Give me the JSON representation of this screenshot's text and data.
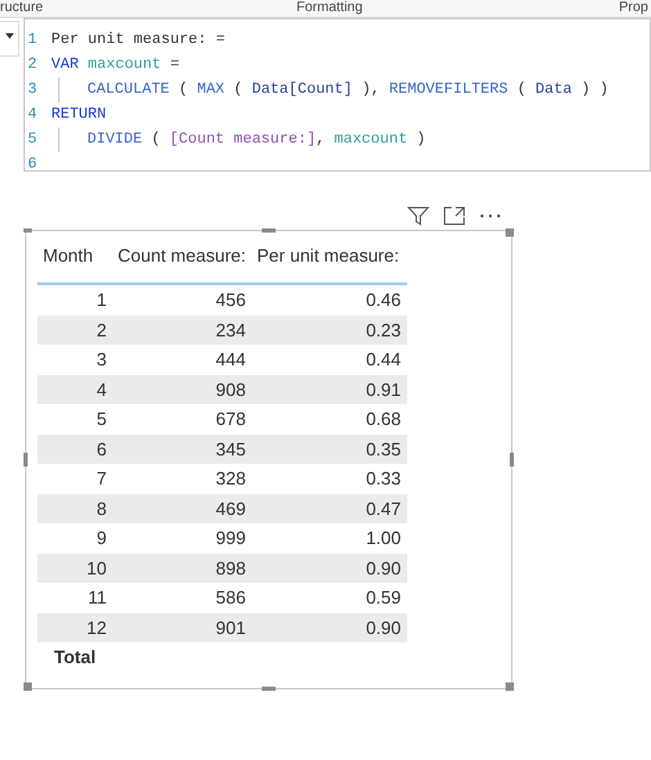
{
  "pane_tabs": [
    "ructure",
    "Formatting",
    "Prop"
  ],
  "editor": {
    "lines": [
      {
        "number": "1",
        "indent": false,
        "tokens": [
          {
            "kind": "text",
            "text": "Per unit measure: ="
          }
        ]
      },
      {
        "number": "2",
        "indent": false,
        "tokens": [
          {
            "kind": "keyword",
            "text": "VAR"
          },
          {
            "kind": "variable",
            "text": " maxcount"
          },
          {
            "kind": "text",
            "text": " ="
          }
        ]
      },
      {
        "number": "3",
        "indent": true,
        "tokens": [
          {
            "kind": "function",
            "text": "CALCULATE"
          },
          {
            "kind": "text",
            "text": " ( "
          },
          {
            "kind": "function",
            "text": "MAX"
          },
          {
            "kind": "text",
            "text": " ( "
          },
          {
            "kind": "column",
            "text": "Data[Count]"
          },
          {
            "kind": "text",
            "text": " ), "
          },
          {
            "kind": "function",
            "text": "REMOVEFILTERS"
          },
          {
            "kind": "text",
            "text": " ( "
          },
          {
            "kind": "column",
            "text": "Data"
          },
          {
            "kind": "text",
            "text": " ) )"
          }
        ]
      },
      {
        "number": "4",
        "indent": false,
        "tokens": [
          {
            "kind": "keyword",
            "text": "RETURN"
          }
        ]
      },
      {
        "number": "5",
        "indent": true,
        "tokens": [
          {
            "kind": "function",
            "text": "DIVIDE"
          },
          {
            "kind": "text",
            "text": " ( "
          },
          {
            "kind": "measure",
            "text": "[Count measure:]"
          },
          {
            "kind": "text",
            "text": ", "
          },
          {
            "kind": "variable",
            "text": "maxcount"
          },
          {
            "kind": "text",
            "text": " )"
          }
        ]
      },
      {
        "number": "6",
        "indent": false
      }
    ]
  },
  "table": {
    "columns": [
      "Month",
      "Count measure:",
      "Per unit measure:"
    ],
    "rows": [
      [
        "1",
        "456",
        "0.46"
      ],
      [
        "2",
        "234",
        "0.23"
      ],
      [
        "3",
        "444",
        "0.44"
      ],
      [
        "4",
        "908",
        "0.91"
      ],
      [
        "5",
        "678",
        "0.68"
      ],
      [
        "6",
        "345",
        "0.35"
      ],
      [
        "7",
        "328",
        "0.33"
      ],
      [
        "8",
        "469",
        "0.47"
      ],
      [
        "9",
        "999",
        "1.00"
      ],
      [
        "10",
        "898",
        "0.90"
      ],
      [
        "11",
        "586",
        "0.59"
      ],
      [
        "12",
        "901",
        "0.90"
      ]
    ],
    "total_label": "Total"
  }
}
